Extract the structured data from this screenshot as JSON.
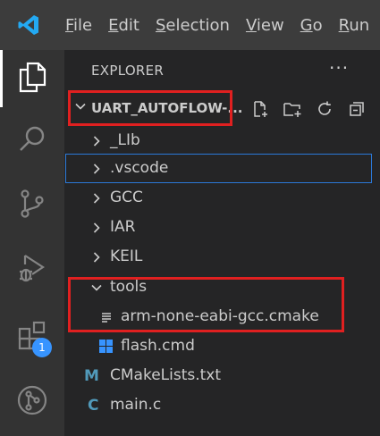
{
  "menubar": {
    "items": [
      {
        "underline": "F",
        "rest": "ile"
      },
      {
        "underline": "E",
        "rest": "dit"
      },
      {
        "underline": "S",
        "rest": "election"
      },
      {
        "underline": "V",
        "rest": "iew"
      },
      {
        "underline": "G",
        "rest": "o"
      },
      {
        "underline": "R",
        "rest": "un"
      }
    ]
  },
  "activitybar": {
    "items": [
      "files-icon",
      "search-icon",
      "source-control-icon",
      "run-debug-icon",
      "extensions-icon",
      "git-graph-icon"
    ],
    "extensions_badge": "1"
  },
  "sidebar": {
    "title": "EXPLORER",
    "more_label": "···",
    "folder": {
      "name": "UART_AUTOFLOW-...",
      "actions": [
        "new-file-icon",
        "new-folder-icon",
        "refresh-icon",
        "collapse-all-icon"
      ]
    },
    "tree": [
      {
        "label": "_LIb",
        "kind": "folder",
        "expanded": false
      },
      {
        "label": ".vscode",
        "kind": "folder",
        "expanded": false
      },
      {
        "label": "GCC",
        "kind": "folder",
        "expanded": false
      },
      {
        "label": "IAR",
        "kind": "folder",
        "expanded": false
      },
      {
        "label": "KEIL",
        "kind": "folder",
        "expanded": false
      },
      {
        "label": "tools",
        "kind": "folder",
        "expanded": true
      },
      {
        "label": "arm-none-eabi-gcc.cmake",
        "kind": "file-lines"
      },
      {
        "label": "flash.cmd",
        "kind": "file-windows"
      },
      {
        "label": "CMakeLists.txt",
        "kind": "file-cmake",
        "glyph": "M"
      },
      {
        "label": "main.c",
        "kind": "file-c",
        "glyph": "C"
      }
    ]
  },
  "colors": {
    "accent": "#3794ff",
    "highlight_box": "#e02020",
    "focus_outline": "#2b79d8"
  }
}
